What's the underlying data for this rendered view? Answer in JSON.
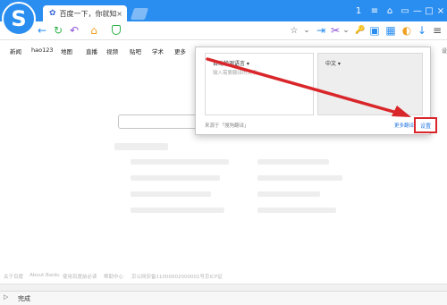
{
  "colors": {
    "accent": "#2a8ef0",
    "highlight": "#d9262a",
    "link": "#2a7ae2"
  },
  "browser": {
    "logo_glyph": "S",
    "tab": {
      "icon": "paw-icon",
      "icon_glyph": "✿",
      "title": "百度一下，你就知道",
      "close_glyph": "×"
    },
    "window_controls": [
      "1",
      "≡",
      "⌂",
      "▭",
      "—",
      "□",
      "×"
    ]
  },
  "toolbar": {
    "back_glyph": "←",
    "refresh_glyph": "↻",
    "undo_glyph": "↶",
    "home_glyph": "⌂",
    "right_icons": [
      "☆",
      "⌄",
      "⇥",
      "✂",
      "⌄",
      "🔑",
      "▣",
      "▦",
      "◐",
      "↓",
      "≡"
    ]
  },
  "nav_links": [
    "新闻",
    "hao123",
    "地图",
    "直播",
    "视频",
    "贴吧",
    "学术",
    "更多"
  ],
  "right_edge_text": "设",
  "footer_links": [
    "关于百度",
    "About Baidu",
    "使用百度前必读",
    "帮助中心",
    "京公网安备11000002000001号",
    "京ICP证"
  ],
  "status": {
    "text": "完成"
  },
  "translate_popup": {
    "source_lang": "自动检测语言 ▾",
    "placeholder": "输入需要翻译的文字",
    "target_lang": "中文 ▾",
    "source_note": "来源于「搜狗翻译」",
    "more_link": "更多翻译",
    "settings_label": "设置"
  }
}
